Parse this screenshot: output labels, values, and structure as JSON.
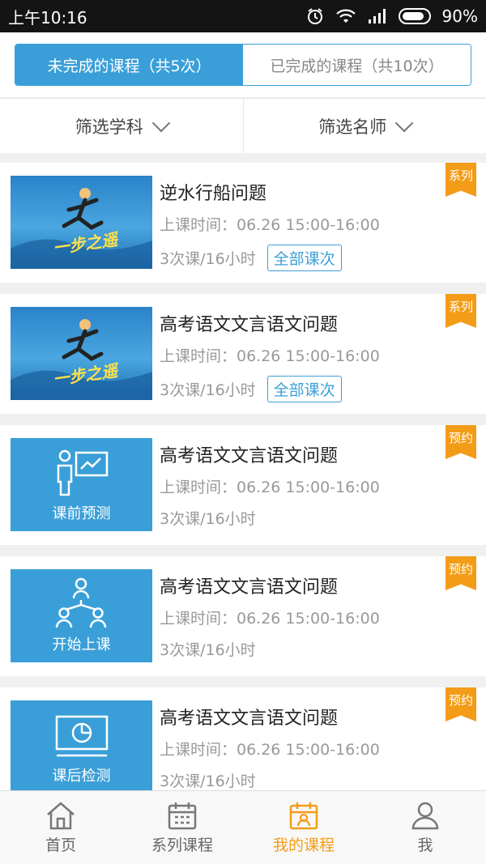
{
  "status_bar": {
    "time": "上午10:16",
    "battery": "90%"
  },
  "tabs": [
    {
      "label": "未完成的课程（共5次）",
      "active": true
    },
    {
      "label": "已完成的课程（共10次）",
      "active": false
    }
  ],
  "filters": [
    {
      "label": "筛选学科"
    },
    {
      "label": "筛选名师"
    }
  ],
  "courses": [
    {
      "title": "逆水行船问题",
      "time": "上课时间：06.26 15:00-16:00",
      "meta": "3次课/16小时",
      "button": "全部课次",
      "badge": "系列",
      "thumb_caption": "",
      "thumb_type": "photo",
      "thumb_text": "一步之遥"
    },
    {
      "title": "高考语文文言语文问题",
      "time": "上课时间：06.26 15:00-16:00",
      "meta": "3次课/16小时",
      "button": "全部课次",
      "badge": "系列",
      "thumb_caption": "",
      "thumb_type": "photo",
      "thumb_text": "一步之遥"
    },
    {
      "title": "高考语文文言语文问题",
      "time": "上课时间：06.26 15:00-16:00",
      "meta": "3次课/16小时",
      "button": "",
      "badge": "预约",
      "thumb_caption": "课前预测",
      "thumb_type": "presenter-icon",
      "thumb_text": ""
    },
    {
      "title": "高考语文文言语文问题",
      "time": "上课时间：06.26 15:00-16:00",
      "meta": "3次课/16小时",
      "button": "",
      "badge": "预约",
      "thumb_caption": "开始上课",
      "thumb_type": "group-icon",
      "thumb_text": ""
    },
    {
      "title": "高考语文文言语文问题",
      "time": "上课时间：06.26 15:00-16:00",
      "meta": "3次课/16小时",
      "button": "",
      "badge": "预约",
      "thumb_caption": "课后检测",
      "thumb_type": "pie-board-icon",
      "thumb_text": ""
    }
  ],
  "bottom_nav": [
    {
      "label": "首页",
      "icon": "home-icon",
      "active": false
    },
    {
      "label": "系列课程",
      "icon": "calendar-icon",
      "active": false
    },
    {
      "label": "我的课程",
      "icon": "my-course-icon",
      "active": true
    },
    {
      "label": "我",
      "icon": "user-icon",
      "active": false
    }
  ],
  "colors": {
    "primary": "#3a9fd8",
    "accent": "#f39c17"
  }
}
